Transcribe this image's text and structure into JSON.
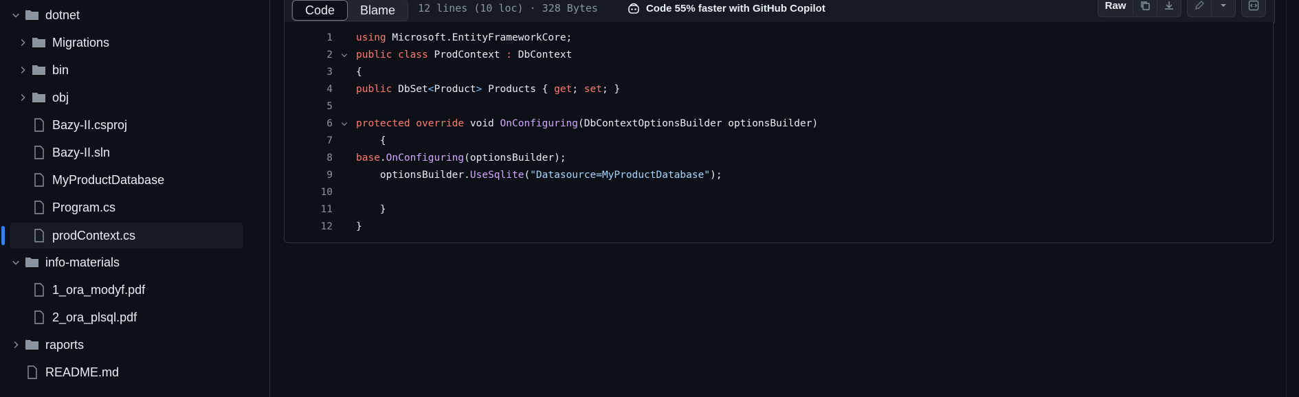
{
  "sidebar": {
    "items": [
      {
        "label": "dotnet",
        "type": "folder",
        "expanded": true,
        "level": 0
      },
      {
        "label": "Migrations",
        "type": "folder",
        "expanded": false,
        "level": 1
      },
      {
        "label": "bin",
        "type": "folder",
        "expanded": false,
        "level": 1
      },
      {
        "label": "obj",
        "type": "folder",
        "expanded": false,
        "level": 1
      },
      {
        "label": "Bazy-II.csproj",
        "type": "file",
        "level": 1
      },
      {
        "label": "Bazy-II.sln",
        "type": "file",
        "level": 1
      },
      {
        "label": "MyProductDatabase",
        "type": "file",
        "level": 1
      },
      {
        "label": "Program.cs",
        "type": "file",
        "level": 1
      },
      {
        "label": "prodContext.cs",
        "type": "file",
        "level": 1,
        "selected": true
      },
      {
        "label": "info-materials",
        "type": "folder",
        "expanded": true,
        "level": 0
      },
      {
        "label": "1_ora_modyf.pdf",
        "type": "file",
        "level": 1
      },
      {
        "label": "2_ora_plsql.pdf",
        "type": "file",
        "level": 1
      },
      {
        "label": "raports",
        "type": "folder",
        "expanded": false,
        "level": 0
      },
      {
        "label": "README.md",
        "type": "file",
        "level": 0
      }
    ]
  },
  "toolbar": {
    "code_tab": "Code",
    "blame_tab": "Blame",
    "meta": "12 lines (10 loc) · 328 Bytes",
    "copilot": "Code 55% faster with GitHub Copilot",
    "raw_label": "Raw"
  },
  "code": {
    "lines": [
      {
        "n": "1",
        "text": "using Microsoft.EntityFrameworkCore;"
      },
      {
        "n": "2",
        "text": "public class ProdContext : DbContext",
        "fold": true
      },
      {
        "n": "3",
        "text": "{"
      },
      {
        "n": "4",
        "text": "    public DbSet<Product> Products { get; set; }"
      },
      {
        "n": "5",
        "text": ""
      },
      {
        "n": "6",
        "text": "    protected override void OnConfiguring(DbContextOptionsBuilder optionsBuilder)",
        "fold": true
      },
      {
        "n": "7",
        "text": "    {"
      },
      {
        "n": "8",
        "text": "    base.OnConfiguring(optionsBuilder);"
      },
      {
        "n": "9",
        "text": "    optionsBuilder.UseSqlite(\"Datasource=MyProductDatabase\");"
      },
      {
        "n": "10",
        "text": ""
      },
      {
        "n": "11",
        "text": "    }"
      },
      {
        "n": "12",
        "text": "}"
      }
    ]
  },
  "colors": {
    "accent": "#2f81f7",
    "keyword": "#ff7b72",
    "function": "#d2a8ff",
    "string": "#a5d6ff"
  }
}
